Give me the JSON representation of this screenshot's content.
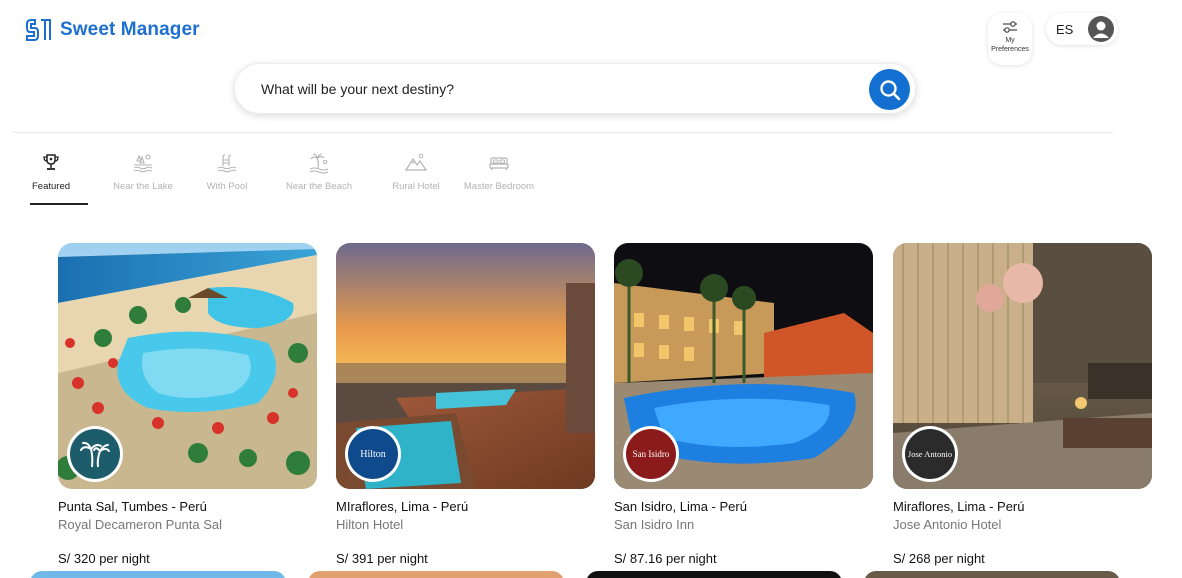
{
  "app": {
    "name": "Sweet Manager"
  },
  "header": {
    "preferences_label": "My Preferences",
    "language": "ES"
  },
  "search": {
    "placeholder": "What will be your next destiny?"
  },
  "categories": [
    {
      "label": "Featured",
      "icon": "trophy-icon",
      "active": true
    },
    {
      "label": "Near the Lake",
      "icon": "lake-icon",
      "active": false
    },
    {
      "label": "With Pool",
      "icon": "pool-icon",
      "active": false
    },
    {
      "label": "Near the Beach",
      "icon": "beach-icon",
      "active": false
    },
    {
      "label": "Rural Hotel",
      "icon": "mountain-icon",
      "active": false
    },
    {
      "label": "Master Bedroom",
      "icon": "bed-icon",
      "active": false
    }
  ],
  "hotels": [
    {
      "location": "Punta Sal, Tumbes - Perú",
      "name": "Royal Decameron Punta Sal",
      "price": "S/ 320 per night",
      "badge": "",
      "badge_color": "#1d5d6b"
    },
    {
      "location": "MIraflores, Lima - Perú",
      "name": "Hilton Hotel",
      "price": "S/ 391 per night",
      "badge": "Hilton",
      "badge_color": "#0e4a8c"
    },
    {
      "location": "San Isidro, Lima - Perú",
      "name": "San Isidro Inn",
      "price": "S/ 87.16 per night",
      "badge": "San Isidro",
      "badge_color": "#8b1b1b"
    },
    {
      "location": "Miraflores, Lima - Perú",
      "name": "Jose Antonio Hotel",
      "price": "S/ 268 per night",
      "badge": "Jose Antonio",
      "badge_color": "#2b2b2b"
    }
  ],
  "colors": {
    "brand": "#1f6fd0",
    "search_button": "#1470d0",
    "inactive_category": "#b3b3b3"
  }
}
